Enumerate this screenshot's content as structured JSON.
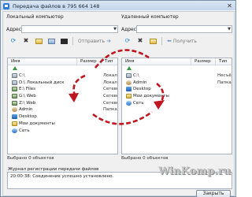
{
  "window": {
    "title": "Передача файлов в 795 664 148",
    "close_glyph": "✕"
  },
  "local": {
    "pane_label": "Локальный компьютер",
    "address_label": "Адрес",
    "address_value": "",
    "columns": [
      "Имя",
      "Размер",
      "Тип"
    ],
    "items": [
      {
        "icon": "up-icon",
        "name": "",
        "size": "",
        "type": ""
      },
      {
        "icon": "drive-icon",
        "name": "C:\\",
        "size": "",
        "type": "Локаль"
      },
      {
        "icon": "drive-icon",
        "name": "D:\\ Локальный диск",
        "size": "",
        "type": "Локаль"
      },
      {
        "icon": "network-drive-icon",
        "name": "E:\\ Files",
        "size": "",
        "type": "Сетево"
      },
      {
        "icon": "network-drive-icon",
        "name": "G:\\ Web",
        "size": "",
        "type": "Сетево"
      },
      {
        "icon": "network-drive-icon",
        "name": "Z:\\ Web",
        "size": "",
        "type": "Сетево"
      },
      {
        "icon": "user-folder-icon",
        "name": "Admin",
        "size": "",
        "type": "Папка с"
      },
      {
        "icon": "desktop-icon",
        "name": "Desktop",
        "size": "",
        "type": ""
      },
      {
        "icon": "documents-icon",
        "name": "Мои документы",
        "size": "",
        "type": ""
      },
      {
        "icon": "network-icon",
        "name": "Сеть",
        "size": "",
        "type": ""
      }
    ],
    "send_label": "Отправить",
    "status": "Выбрано 0 объектов"
  },
  "remote": {
    "pane_label": "Удаленный компьютер",
    "address_label": "Адрес",
    "address_value": "",
    "columns": [
      "Имя",
      "Размер",
      "Тип"
    ],
    "items": [
      {
        "icon": "up-icon",
        "name": "",
        "size": "",
        "type": ""
      },
      {
        "icon": "drive-icon",
        "name": "C:\\",
        "size": "",
        "type": "Несъём"
      },
      {
        "icon": "user-folder-icon",
        "name": "Admin",
        "size": "",
        "type": "Папка с"
      },
      {
        "icon": "desktop-icon",
        "name": "Desktop",
        "size": "",
        "type": ""
      },
      {
        "icon": "documents-icon",
        "name": "Мои документы",
        "size": "",
        "type": ""
      },
      {
        "icon": "network-icon",
        "name": "Сеть",
        "size": "",
        "type": ""
      }
    ],
    "receive_label": "Получить",
    "status": "Выбрано 0 объектов"
  },
  "log": {
    "label": "Журнал регистрации передачи файлов",
    "entry": "20:00:38: Соединение успешно установлено."
  },
  "buttons": {
    "close_label": "Закрыть"
  },
  "watermark": "WinKomp.ru",
  "colors": {
    "arrow": "#c0161f",
    "accent": "#2e7bd6"
  }
}
